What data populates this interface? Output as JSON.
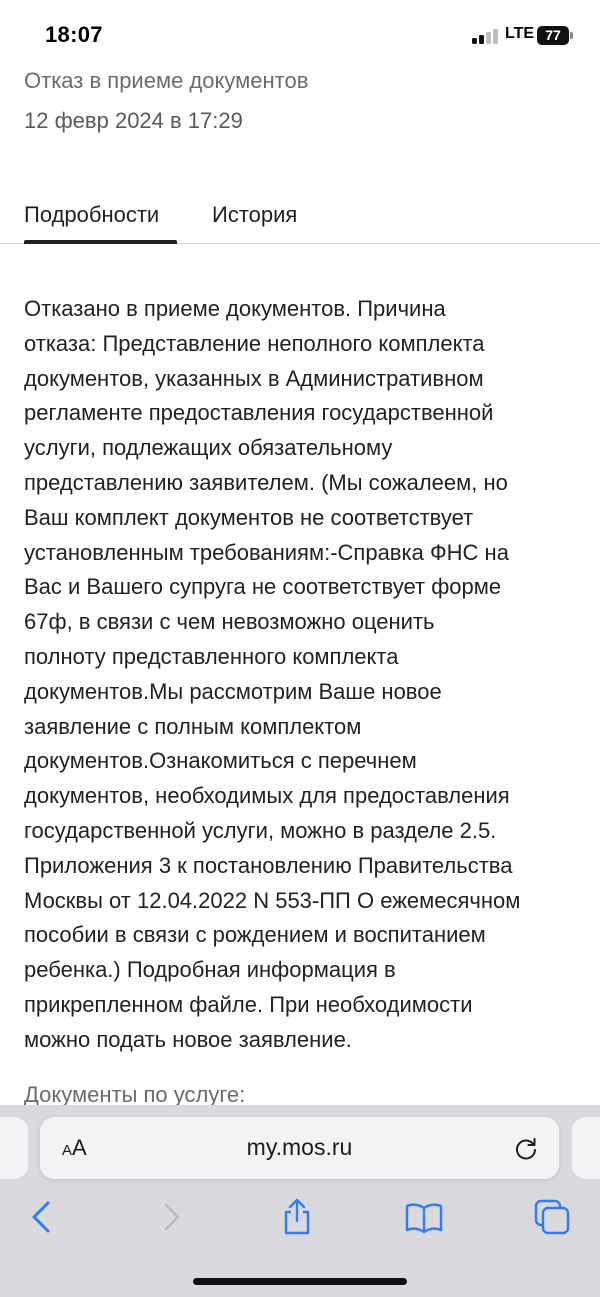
{
  "status_bar": {
    "time": "18:07",
    "network": "LTE",
    "battery": "77"
  },
  "header": {
    "title": "Отказ в приеме документов",
    "date": "12 февр 2024 в 17:29"
  },
  "tabs": [
    {
      "label": "Подробности",
      "active": true
    },
    {
      "label": "История",
      "active": false
    }
  ],
  "details_text": "Отказано в приеме документов. Причина\nотказа: Представление неполного комплекта\nдокументов, указанных в Административном\nрегламенте предоставления государственной\nуслуги, подлежащих обязательному\nпредставлению заявителем. (Мы сожалеем, но\nВаш комплект документов не соответствует\nустановленным требованиям:-Справка ФНС на\nВас и Вашего супруга не соответствует форме\n67ф, в связи с чем невозможно оценить\nполноту представленного комплекта\nдокументов.Мы рассмотрим Ваше новое\nзаявление с полным комплектом\nдокументов.Ознакомиться с перечнем\nдокументов, необходимых для предоставления\nгосударственной услуги, можно в разделе 2.5.\nПриложения 3 к постановлению Правительства\nМосквы от 12.04.2022 N 553-ПП О ежемесячном\nпособии в связи с рождением и воспитанием\nребенка.) Подробная информация в\nприкрепленном файле. При необходимости\nможно подать новое заявление.",
  "documents_heading": "Документы по услуге:",
  "browser": {
    "aa_label_small": "A",
    "aa_label_large": "A",
    "url": "my.mos.ru"
  },
  "toolbar_icons": [
    "back-icon",
    "forward-icon",
    "share-icon",
    "bookmarks-icon",
    "tabs-icon"
  ],
  "colors": {
    "accent": "#2f7cf6",
    "disabled": "#b9b9bd",
    "toolbar_bg": "#dad9de"
  }
}
